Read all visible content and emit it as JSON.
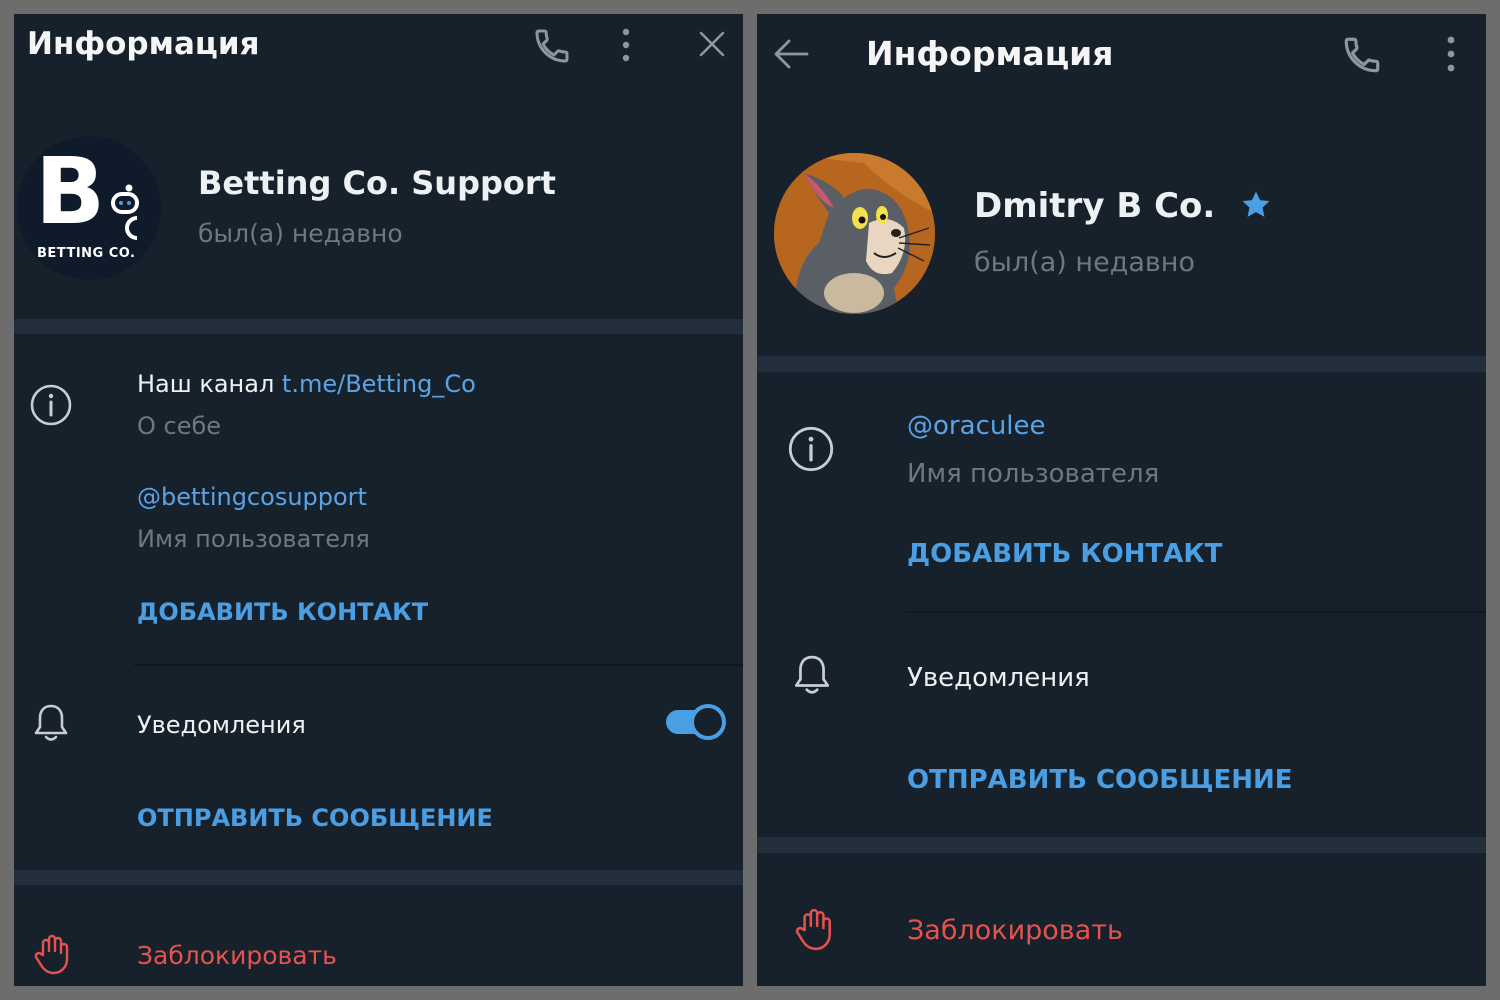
{
  "colors": {
    "panel_bg": "#17212b",
    "separator": "#232e3c",
    "accent": "#4a9fe4",
    "link": "#5aa3e6",
    "muted": "#6d7883",
    "danger": "#e5524f",
    "toggle_on": "#4a9fe4",
    "star": "#4a9fe4"
  },
  "left": {
    "header": {
      "title": "Информация",
      "icons": [
        "phone-icon",
        "more-vertical-icon",
        "close-icon"
      ]
    },
    "profile": {
      "name": "Betting Co. Support",
      "status": "был(а) недавно",
      "avatar": {
        "logo_text": "BETTING CO.",
        "logo_letter": "B",
        "logo_sub": "Co",
        "bg": "#0f1a2b"
      }
    },
    "bio": {
      "prefix": "Наш канал ",
      "link": "t.me/Betting_Co",
      "label": "О себе"
    },
    "username": {
      "value": "@bettingcosupport",
      "label": "Имя пользователя"
    },
    "add_contact": "ДОБАВИТЬ КОНТАКТ",
    "notifications": {
      "label": "Уведомления",
      "enabled": true
    },
    "send_message": "ОТПРАВИТЬ СООБЩЕНИЕ",
    "block": "Заблокировать"
  },
  "right": {
    "header": {
      "title": "Информация",
      "icons": [
        "back-arrow-icon",
        "phone-icon",
        "more-vertical-icon"
      ]
    },
    "profile": {
      "name": "Dmitry B Co.",
      "status": "был(а) недавно",
      "starred": true,
      "avatar": {
        "bg": "#b7661f"
      }
    },
    "username": {
      "value": "@oraculee",
      "label": "Имя пользователя"
    },
    "add_contact": "ДОБАВИТЬ КОНТАКТ",
    "notifications": {
      "label": "Уведомления"
    },
    "send_message": "ОТПРАВИТЬ СООБЩЕНИЕ",
    "block": "Заблокировать"
  }
}
